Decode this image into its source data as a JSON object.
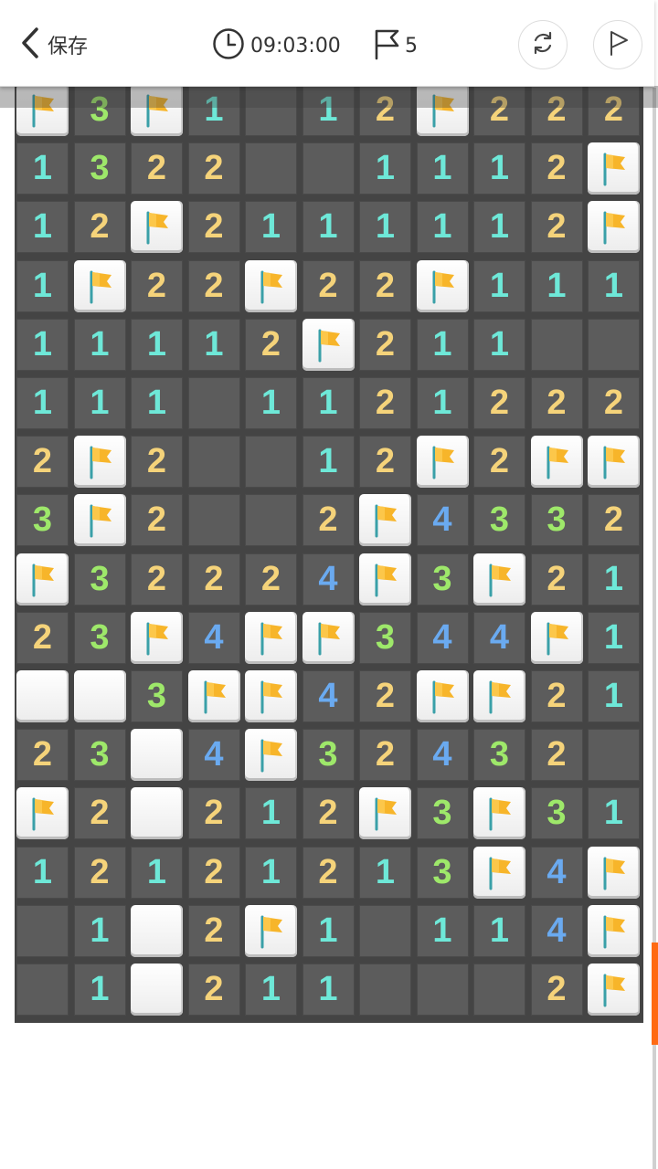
{
  "header": {
    "back_label": "保存",
    "timer": "09:03:00",
    "flags_count": "5"
  },
  "colors": {
    "1": "#6ee8d8",
    "2": "#f5d37a",
    "3": "#9ee86a",
    "4": "#6aaaf0"
  },
  "board": {
    "cols": 11,
    "rows": [
      [
        "F",
        "3",
        "F",
        "1",
        "E",
        "1",
        "2",
        "F",
        "2",
        "2",
        "2"
      ],
      [
        "1",
        "3",
        "2",
        "2",
        "E",
        "E",
        "1",
        "1",
        "1",
        "2",
        "F"
      ],
      [
        "1",
        "2",
        "F",
        "2",
        "1",
        "1",
        "1",
        "1",
        "1",
        "2",
        "F"
      ],
      [
        "1",
        "F",
        "2",
        "2",
        "F",
        "2",
        "2",
        "F",
        "1",
        "1",
        "1"
      ],
      [
        "1",
        "1",
        "1",
        "1",
        "2",
        "F",
        "2",
        "1",
        "1",
        "E",
        "E"
      ],
      [
        "1",
        "1",
        "1",
        "E",
        "1",
        "1",
        "2",
        "1",
        "2",
        "2",
        "2"
      ],
      [
        "2",
        "F",
        "2",
        "E",
        "E",
        "1",
        "2",
        "F",
        "2",
        "F",
        "F"
      ],
      [
        "3",
        "F",
        "2",
        "E",
        "E",
        "2",
        "F",
        "4",
        "3",
        "3",
        "2"
      ],
      [
        "F",
        "3",
        "2",
        "2",
        "2",
        "4",
        "F",
        "3",
        "F",
        "2",
        "1"
      ],
      [
        "2",
        "3",
        "F",
        "4",
        "F",
        "F",
        "3",
        "4",
        "4",
        "F",
        "1"
      ],
      [
        "B",
        "B",
        "3",
        "F",
        "F",
        "4",
        "2",
        "F",
        "F",
        "2",
        "1"
      ],
      [
        "2",
        "3",
        "B",
        "4",
        "F",
        "3",
        "2",
        "4",
        "3",
        "2",
        "E"
      ],
      [
        "F",
        "2",
        "B",
        "2",
        "1",
        "2",
        "F",
        "3",
        "F",
        "3",
        "1"
      ],
      [
        "1",
        "2",
        "1",
        "2",
        "1",
        "2",
        "1",
        "3",
        "F",
        "4",
        "F"
      ],
      [
        "E",
        "1",
        "B",
        "2",
        "F",
        "1",
        "E",
        "1",
        "1",
        "4",
        "F"
      ],
      [
        "E",
        "1",
        "B",
        "2",
        "1",
        "1",
        "E",
        "E",
        "E",
        "2",
        "F"
      ]
    ]
  }
}
